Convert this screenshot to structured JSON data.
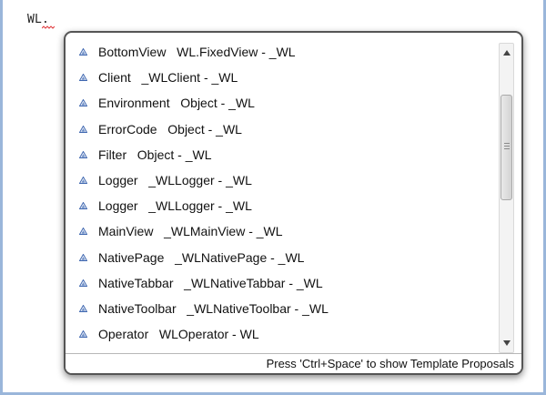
{
  "editor": {
    "code": "WL."
  },
  "proposals": {
    "items": [
      {
        "name": "BottomView",
        "detail": "WL.FixedView - _WL"
      },
      {
        "name": "Client",
        "detail": "_WLClient - _WL"
      },
      {
        "name": "Environment",
        "detail": "Object - _WL"
      },
      {
        "name": "ErrorCode",
        "detail": "Object - _WL"
      },
      {
        "name": "Filter",
        "detail": "Object - _WL"
      },
      {
        "name": "Logger",
        "detail": "_WLLogger - _WL"
      },
      {
        "name": "Logger",
        "detail": "_WLLogger - _WL"
      },
      {
        "name": "MainView",
        "detail": "_WLMainView - _WL"
      },
      {
        "name": "NativePage",
        "detail": "_WLNativePage - _WL"
      },
      {
        "name": "NativeTabbar",
        "detail": "_WLNativeTabbar - _WL"
      },
      {
        "name": "NativeToolbar",
        "detail": "_WLNativeToolbar - _WL"
      },
      {
        "name": "Operator",
        "detail": "WLOperator - WL"
      }
    ],
    "item_icon": "triangle-icon",
    "status_text": "Press 'Ctrl+Space' to show Template Proposals",
    "scroll_position": 0.3
  },
  "colors": {
    "icon_fill": "#6f8fc7",
    "squiggle": "#e0383b",
    "frame": "#9ab6da"
  }
}
